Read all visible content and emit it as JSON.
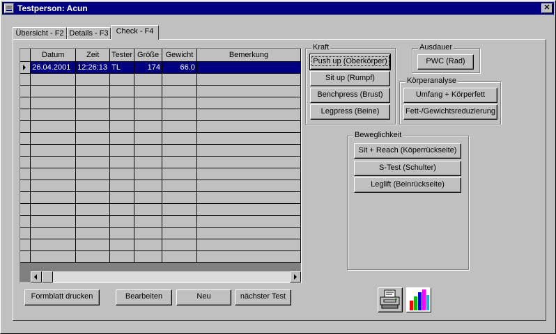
{
  "window": {
    "title": "Testperson: Acun",
    "close_glyph": "✕"
  },
  "tabs": [
    {
      "label": "Übersicht - F2",
      "active": false
    },
    {
      "label": "Details - F3",
      "active": false
    },
    {
      "label": "Check - F4",
      "active": true
    }
  ],
  "grid": {
    "columns": [
      "Datum",
      "Zeit",
      "Tester",
      "Größe",
      "Gewicht",
      "Bemerkung"
    ],
    "rows": [
      {
        "datum": "26.04.2001",
        "zeit": "12:26:13",
        "tester": "TL",
        "groesse": "174",
        "gewicht": "66.0",
        "bemerkung": ""
      }
    ],
    "empty_rows": 16
  },
  "kraft": {
    "title": "Kraft",
    "buttons": [
      "Push up (Oberkörper)",
      "Sit up (Rumpf)",
      "Benchpress (Brust)",
      "Legpress (Beine)"
    ]
  },
  "ausdauer": {
    "title": "Ausdauer",
    "buttons": [
      "PWC (Rad)"
    ]
  },
  "koerperanalyse": {
    "title": "Körperanalyse",
    "buttons": [
      "Umfang + Körperfett",
      "Fett-/Gewichtsreduzierung"
    ]
  },
  "beweglichkeit": {
    "title": "Beweglichkeit",
    "buttons": [
      "Sit + Reach (Köperrückseite)",
      "S-Test (Schulter)",
      "Leglift (Beinrückseite)"
    ]
  },
  "actions": {
    "print_form": "Formblatt drucken",
    "edit": "Bearbeiten",
    "new": "Neu",
    "next_test": "nächster Test"
  },
  "icons": {
    "printer": "printer-icon",
    "chart": "bar-chart-icon"
  }
}
